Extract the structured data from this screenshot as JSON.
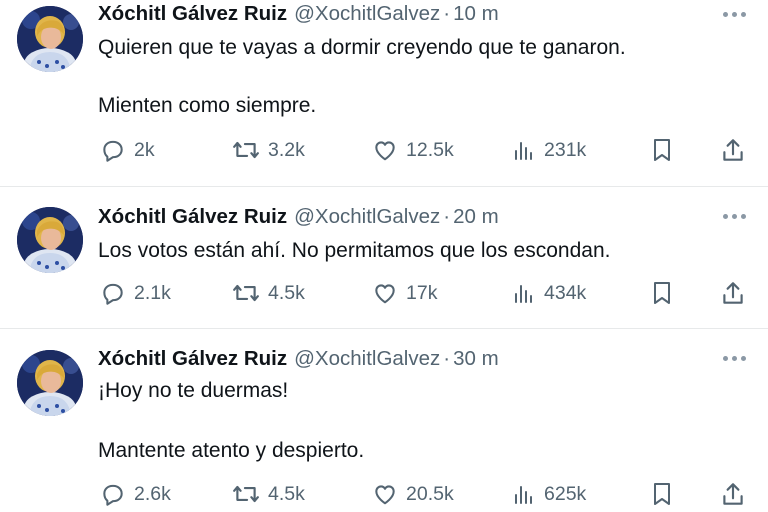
{
  "tweets": [
    {
      "author_name": "Xóchitl Gálvez Ruiz",
      "handle": "@XochitlGalvez",
      "separator": "·",
      "time": "10 m",
      "lines": [
        "Quieren que te vayas a dormir creyendo que te ganaron.",
        "Mienten como siempre."
      ],
      "replies": "2k",
      "reposts": "3.2k",
      "likes": "12.5k",
      "views": "231k"
    },
    {
      "author_name": "Xóchitl Gálvez Ruiz",
      "handle": "@XochitlGalvez",
      "separator": "·",
      "time": "20 m",
      "lines": [
        "Los votos están ahí. No permitamos que los escondan."
      ],
      "replies": "2.1k",
      "reposts": "4.5k",
      "likes": "17k",
      "views": "434k"
    },
    {
      "author_name": "Xóchitl Gálvez Ruiz",
      "handle": "@XochitlGalvez",
      "separator": "·",
      "time": "30 m",
      "lines": [
        "¡Hoy no te duermas!",
        "Mantente atento y despierto."
      ],
      "replies": "2.6k",
      "reposts": "4.5k",
      "likes": "20.5k",
      "views": "625k"
    }
  ],
  "icons": {
    "more": "more-horizontal-icon",
    "reply": "reply-bubble-icon",
    "repost": "repost-arrows-icon",
    "like": "heart-icon",
    "views": "views-bar-chart-icon",
    "bookmark": "bookmark-icon",
    "share": "share-upload-icon"
  },
  "colors": {
    "text_primary": "#0f1419",
    "text_secondary": "#536471",
    "divider": "#e7e9ea",
    "more_dots": "#8b98a5"
  }
}
